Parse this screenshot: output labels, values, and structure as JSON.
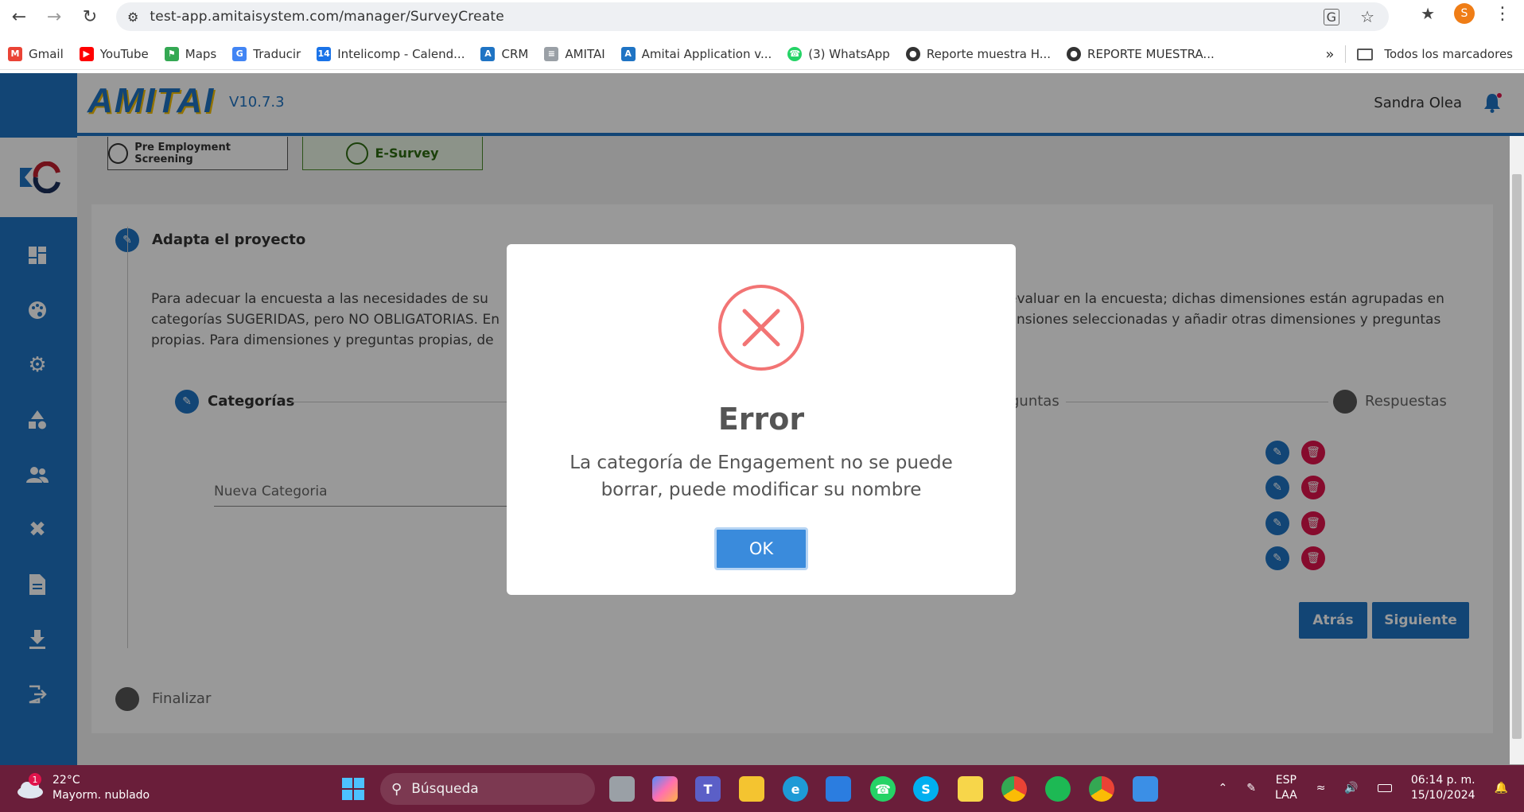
{
  "browser": {
    "url": "test-app.amitaisystem.com/manager/SurveyCreate",
    "profile_initial": "S",
    "bookmarks": [
      {
        "label": "Gmail",
        "color": "#ea4335"
      },
      {
        "label": "YouTube",
        "color": "#ff0000"
      },
      {
        "label": "Maps",
        "color": "#34a853"
      },
      {
        "label": "Traducir",
        "color": "#4285f4"
      },
      {
        "label": "Intelicomp - Calend...",
        "color": "#1a73e8"
      },
      {
        "label": "CRM",
        "color": "#1f74c4"
      },
      {
        "label": "AMITAI",
        "color": "#9aa0a6"
      },
      {
        "label": "Amitai Application v...",
        "color": "#1f74c4"
      },
      {
        "label": "(3) WhatsApp",
        "color": "#25d366"
      },
      {
        "label": "Reporte muestra H...",
        "color": "#333333"
      },
      {
        "label": "REPORTE MUESTRA...",
        "color": "#333333"
      }
    ],
    "all_bookmarks": "Todos los marcadores"
  },
  "app": {
    "brand": "AMITAI",
    "version": "V10.7.3",
    "username": "Sandra Olea",
    "module_tabs": [
      {
        "label": "Pre Employment Screening"
      },
      {
        "label": "E-Survey"
      }
    ],
    "section_title": "Adapta el proyecto",
    "description_left": "Para adecuar la encuesta a las necesidades de su",
    "description_right": "evaluar en la encuesta; dichas dimensiones están agrupadas en",
    "description_left_2": "categorías SUGERIDAS, pero NO OBLIGATORIAS. En",
    "description_right_2": "nsiones seleccionadas y añadir otras dimensiones y preguntas",
    "description_left_3": "propias. Para dimensiones y preguntas propias, de",
    "steps": {
      "categorias": "Categorías",
      "preguntas": "guntas",
      "respuestas": "Respuestas"
    },
    "new_category_placeholder": "Nueva Categoria",
    "buttons": {
      "back": "Atrás",
      "next": "Siguiente"
    },
    "finalizar": "Finalizar"
  },
  "modal": {
    "title": "Error",
    "message": "La categoría de Engagement no se puede borrar, puede modificar su nombre",
    "ok": "OK",
    "accent": "#f27474"
  },
  "taskbar": {
    "temperature": "22°C",
    "weather": "Mayorm. nublado",
    "weather_badge": "1",
    "search": "Búsqueda",
    "lang_1": "ESP",
    "lang_2": "LAA",
    "time": "06:14 p. m.",
    "date": "15/10/2024"
  }
}
